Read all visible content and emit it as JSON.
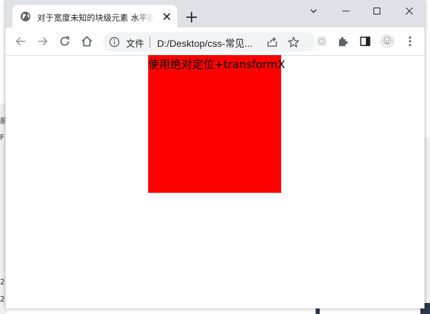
{
  "tab": {
    "title": "对于宽度未知的块级元素 水平居中"
  },
  "omnibox": {
    "scheme": "文件",
    "url": "D:/Desktop/css-常见..."
  },
  "page": {
    "box_text": "使用绝对定位+transformX"
  },
  "background": {
    "frag1": "前",
    "frag2": "F",
    "frag3": "2.",
    "frag4": "2."
  },
  "colors": {
    "box": "#ff0000",
    "titlebar": "#dee1e6"
  }
}
